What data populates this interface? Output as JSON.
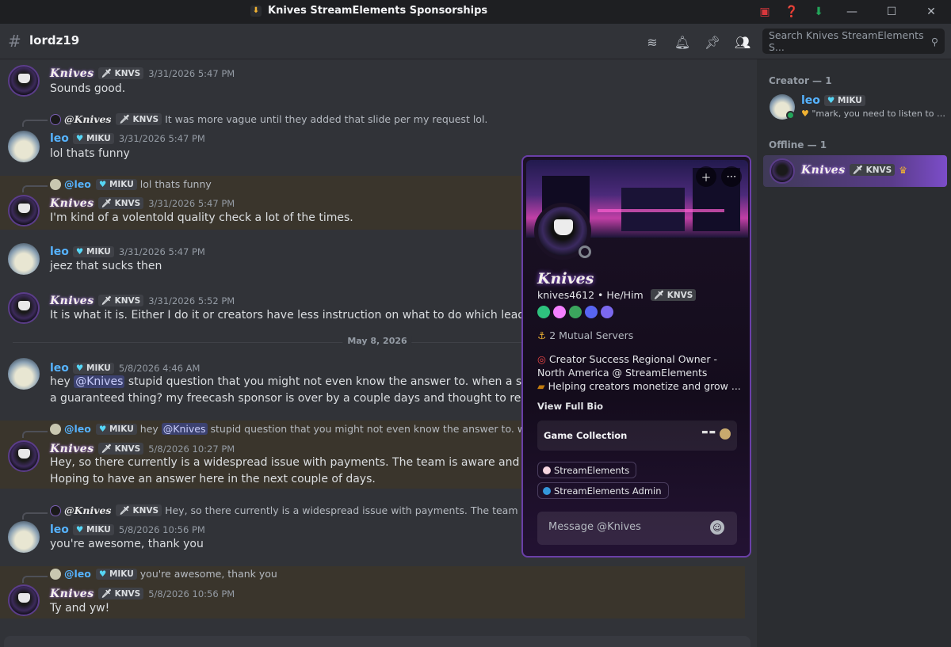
{
  "window": {
    "title": "Knives StreamElements Sponsorships",
    "icons": [
      "screen-share-icon",
      "help-icon",
      "download-icon"
    ],
    "controls": [
      "minimize-icon",
      "maximize-icon",
      "close-icon"
    ]
  },
  "header": {
    "channel": "lordz19",
    "search_placeholder": "Search Knives StreamElements S...",
    "icons": [
      "threads-icon",
      "bell-icon",
      "pin-icon",
      "members-icon"
    ]
  },
  "colors": {
    "accent": "#7c4dc9",
    "leo": "#56b3ff",
    "mention_bg": "#3c4270",
    "highlight": "#3a352c"
  },
  "chat": {
    "date_divider": "May 8, 2026",
    "messages": [
      {
        "author": "Knives",
        "tag": "KNVS",
        "time": "3/31/2026 5:47 PM",
        "text": "Sounds good."
      },
      {
        "reply_author": "@Knives",
        "reply_tag": "KNVS",
        "reply_text": "It was more vague until they added that slide per my request lol.",
        "author": "leo",
        "tag": "MIKU",
        "time": "3/31/2026 5:47 PM",
        "text": "lol thats funny"
      },
      {
        "reply_author": "@leo",
        "reply_tag": "MIKU",
        "reply_text": "lol thats funny",
        "author": "Knives",
        "tag": "KNVS",
        "time": "3/31/2026 5:47 PM",
        "text": "I'm kind of a volentold quality check a lot of the times."
      },
      {
        "author": "leo",
        "tag": "MIKU",
        "time": "3/31/2026 5:47 PM",
        "text": "jeez that sucks then"
      },
      {
        "author": "Knives",
        "tag": "KNVS",
        "time": "3/31/2026 5:52 PM",
        "text": "It is what it is. Either I do it or creators have less instruction on what to do which leads to poor"
      },
      {
        "author": "leo",
        "tag": "MIKU",
        "time": "5/8/2026 4:46 AM",
        "text_a": "hey ",
        "mention": "@Knives",
        "text_b": " stupid question that you might not even know the answer to. when a sponsor sa",
        "text2": "a guaranteed thing? my freecash sponsor is over by a couple days and thought to reach out"
      },
      {
        "reply_author": "@leo",
        "reply_tag": "MIKU",
        "reply_text_a": "hey ",
        "reply_mention": "@Knives",
        "reply_text_b": " stupid question that you might not even know the answer to. when a spons",
        "author": "Knives",
        "tag": "KNVS",
        "time": "5/8/2026 10:27 PM",
        "text": "Hey, so there currently is a widespread issue with payments. The team is aware and is investig",
        "text2": "Hoping to have an answer here in the next couple of days."
      },
      {
        "reply_author": "@Knives",
        "reply_tag": "KNVS",
        "reply_text": "Hey, so there currently is a widespread issue with payments. The team is aware and",
        "author": "leo",
        "tag": "MIKU",
        "time": "5/8/2026 10:56 PM",
        "text": "you're awesome, thank you"
      },
      {
        "reply_author": "@leo",
        "reply_tag": "MIKU",
        "reply_text": "you're awesome, thank you",
        "author": "Knives",
        "tag": "KNVS",
        "time": "5/8/2026 10:56 PM",
        "text": "Ty and yw!"
      }
    ]
  },
  "members": {
    "creator_heading": "Creator — 1",
    "offline_heading": "Offline — 1",
    "creator": {
      "name": "leo",
      "tag": "MIKU",
      "status": "\"mark, you need to listen to rad..."
    },
    "offline": {
      "name": "Knives",
      "tag": "KNVS"
    }
  },
  "profile": {
    "display_name": "Knives",
    "username": "knives4612",
    "pronouns": "He/Him",
    "tag": "KNVS",
    "mutual_servers": "2 Mutual Servers",
    "bio_line1": "Creator Success Regional Owner - North America @ StreamElements",
    "bio_line2": "Helping creators monetize and grow ...",
    "view_bio": "View Full Bio",
    "game_collection": "Game Collection",
    "roles": [
      "StreamElements",
      "StreamElements Admin"
    ],
    "message_placeholder": "Message @Knives",
    "badges": [
      "nitro-icon",
      "boost-icon",
      "hypesquad-icon",
      "quest-icon",
      "orb-icon"
    ]
  }
}
